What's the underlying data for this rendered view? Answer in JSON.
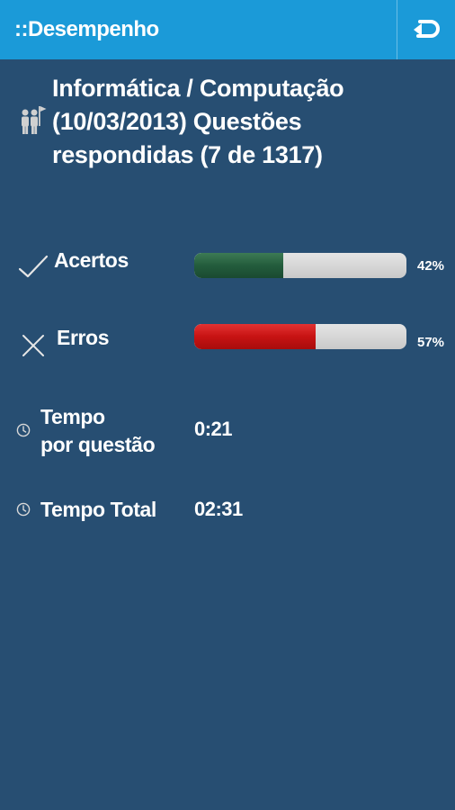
{
  "app_bar": {
    "title": "::Desempenho",
    "back_icon": "back-arrow-icon",
    "color": "#1b9ad8"
  },
  "header": {
    "icon": "people-flag-icon",
    "text": "Informática / Computação (10/03/2013) Questões respondidas (7 de 1317)"
  },
  "stats": {
    "acertos": {
      "icon": "checkmark-icon",
      "label": "Acertos",
      "percent_label": "42%",
      "fraction": 0.42,
      "color": "#235c3c"
    },
    "erros": {
      "icon": "x-mark-icon",
      "label": "Erros",
      "percent_label": "57%",
      "fraction": 0.57,
      "color": "#c71313"
    }
  },
  "times": {
    "per_question": {
      "icon": "clock-icon",
      "label_line1": "Tempo",
      "label_line2": "por questão",
      "value": "0:21"
    },
    "total": {
      "icon": "clock-icon",
      "label": "Tempo Total",
      "value": "02:31"
    }
  },
  "background_color": "#274e72"
}
